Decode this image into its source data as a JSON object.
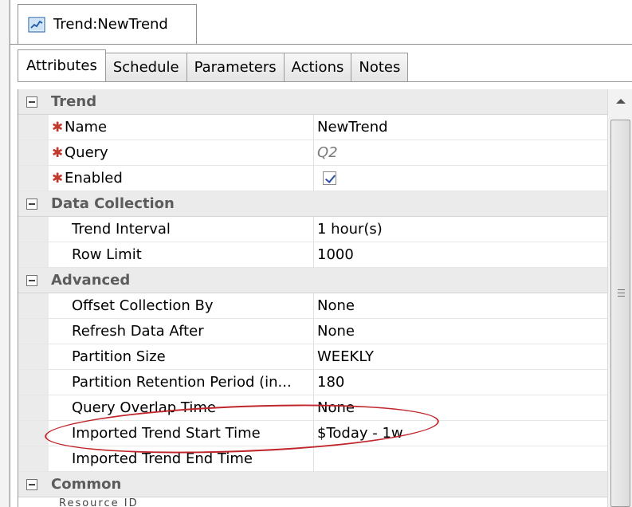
{
  "document_tab": {
    "title": "Trend:NewTrend",
    "icon": "trend-chart-icon"
  },
  "tabs": [
    {
      "label": "Attributes",
      "active": true
    },
    {
      "label": "Schedule",
      "active": false
    },
    {
      "label": "Parameters",
      "active": false
    },
    {
      "label": "Actions",
      "active": false
    },
    {
      "label": "Notes",
      "active": false
    }
  ],
  "groups": {
    "trend": {
      "label": "Trend"
    },
    "data_collection": {
      "label": "Data Collection"
    },
    "advanced": {
      "label": "Advanced"
    },
    "common": {
      "label": "Common"
    }
  },
  "properties": {
    "name": {
      "label": "Name",
      "value": "NewTrend",
      "required": true
    },
    "query": {
      "label": "Query",
      "value": "Q2",
      "required": true
    },
    "enabled": {
      "label": "Enabled",
      "checked": true,
      "required": true
    },
    "trend_interval": {
      "label": "Trend Interval",
      "value": "1 hour(s)"
    },
    "row_limit": {
      "label": "Row Limit",
      "value": "1000"
    },
    "offset_collection_by": {
      "label": "Offset Collection By",
      "value": "None"
    },
    "refresh_data_after": {
      "label": "Refresh Data After",
      "value": "None"
    },
    "partition_size": {
      "label": "Partition Size",
      "value": "WEEKLY"
    },
    "partition_retention_period": {
      "label": "Partition Retention Period (in...",
      "value": "180"
    },
    "query_overlap_time": {
      "label": "Query Overlap Time",
      "value": "None"
    },
    "imported_trend_start_time": {
      "label": "Imported Trend Start Time",
      "value": "$Today - 1w"
    },
    "imported_trend_end_time": {
      "label": "Imported Trend End Time",
      "value": ""
    }
  },
  "required_marker": "✱",
  "colors": {
    "required": "#c0392b",
    "group_bg": "#ebebeb",
    "annotation": "#c0262b",
    "checkbox_check": "#2a4fa0"
  },
  "bottom_cutoff_text": "Resource ID"
}
